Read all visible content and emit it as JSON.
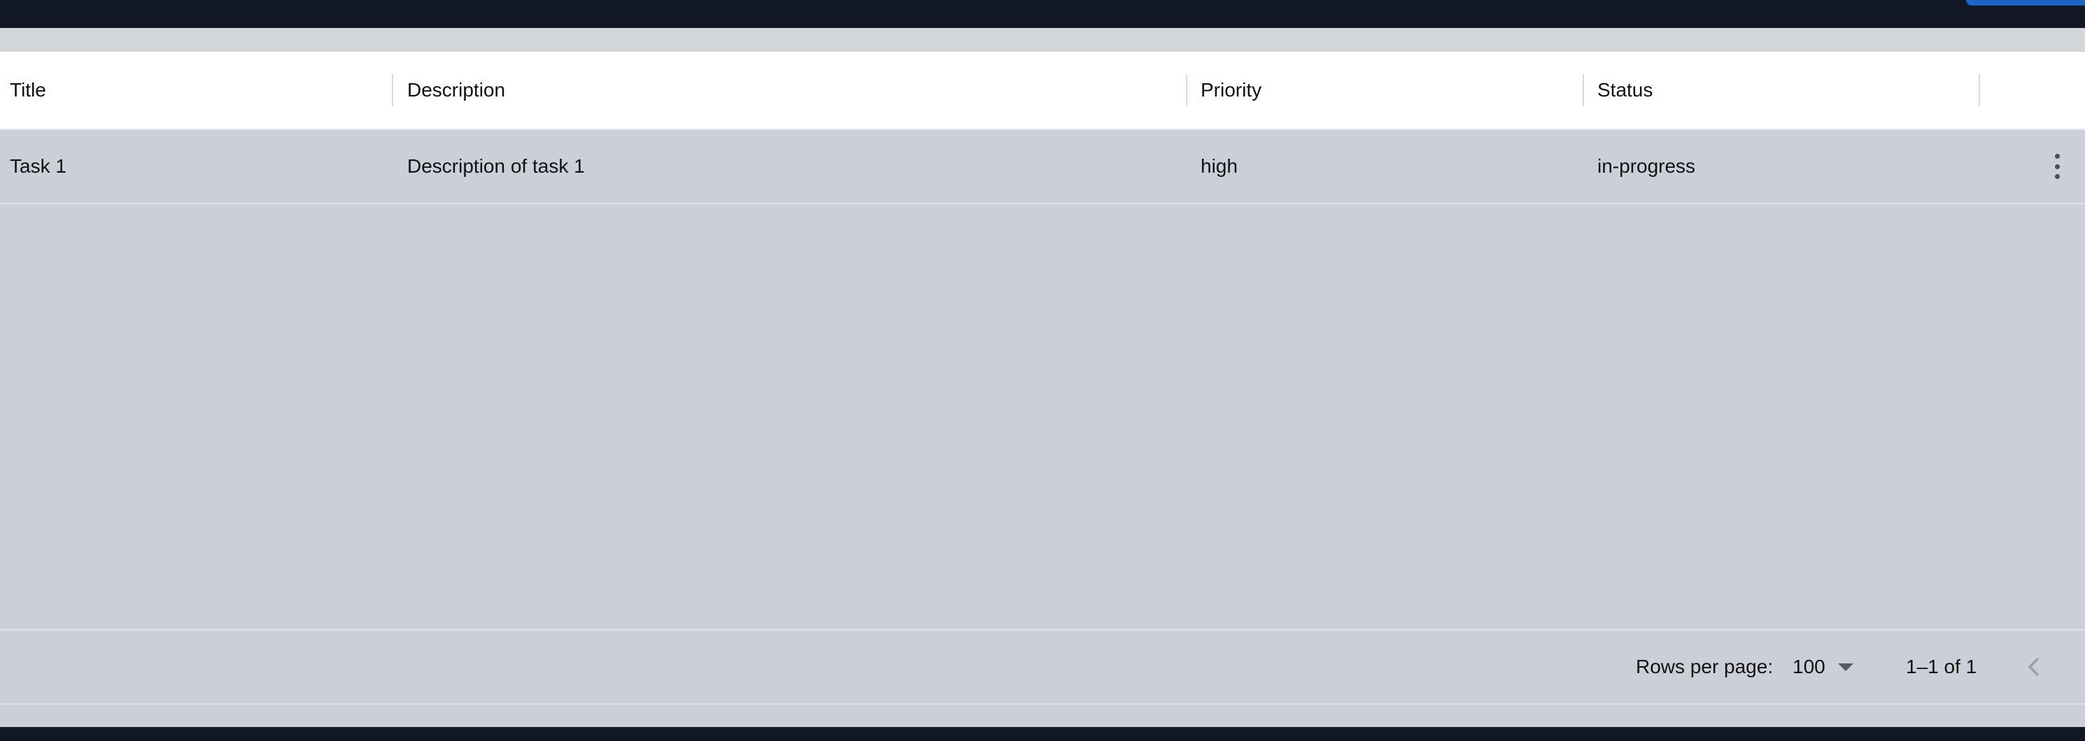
{
  "grid": {
    "columns": [
      "Title",
      "Description",
      "Priority",
      "Status"
    ],
    "rows": [
      {
        "title": "Task 1",
        "description": "Description of task 1",
        "priority": "high",
        "status": "in-progress"
      }
    ],
    "row_actions_icon": "more-vertical-icon"
  },
  "pagination": {
    "rows_per_page_label": "Rows per page:",
    "rows_per_page_value": "100",
    "range_text": "1–1 of 1",
    "prev_icon": "chevron-left-icon"
  },
  "colors": {
    "header_bg": "#ffffff",
    "grid_bg": "#cbcfd7",
    "top_bar": "#121725",
    "accent": "#1d63c9"
  }
}
